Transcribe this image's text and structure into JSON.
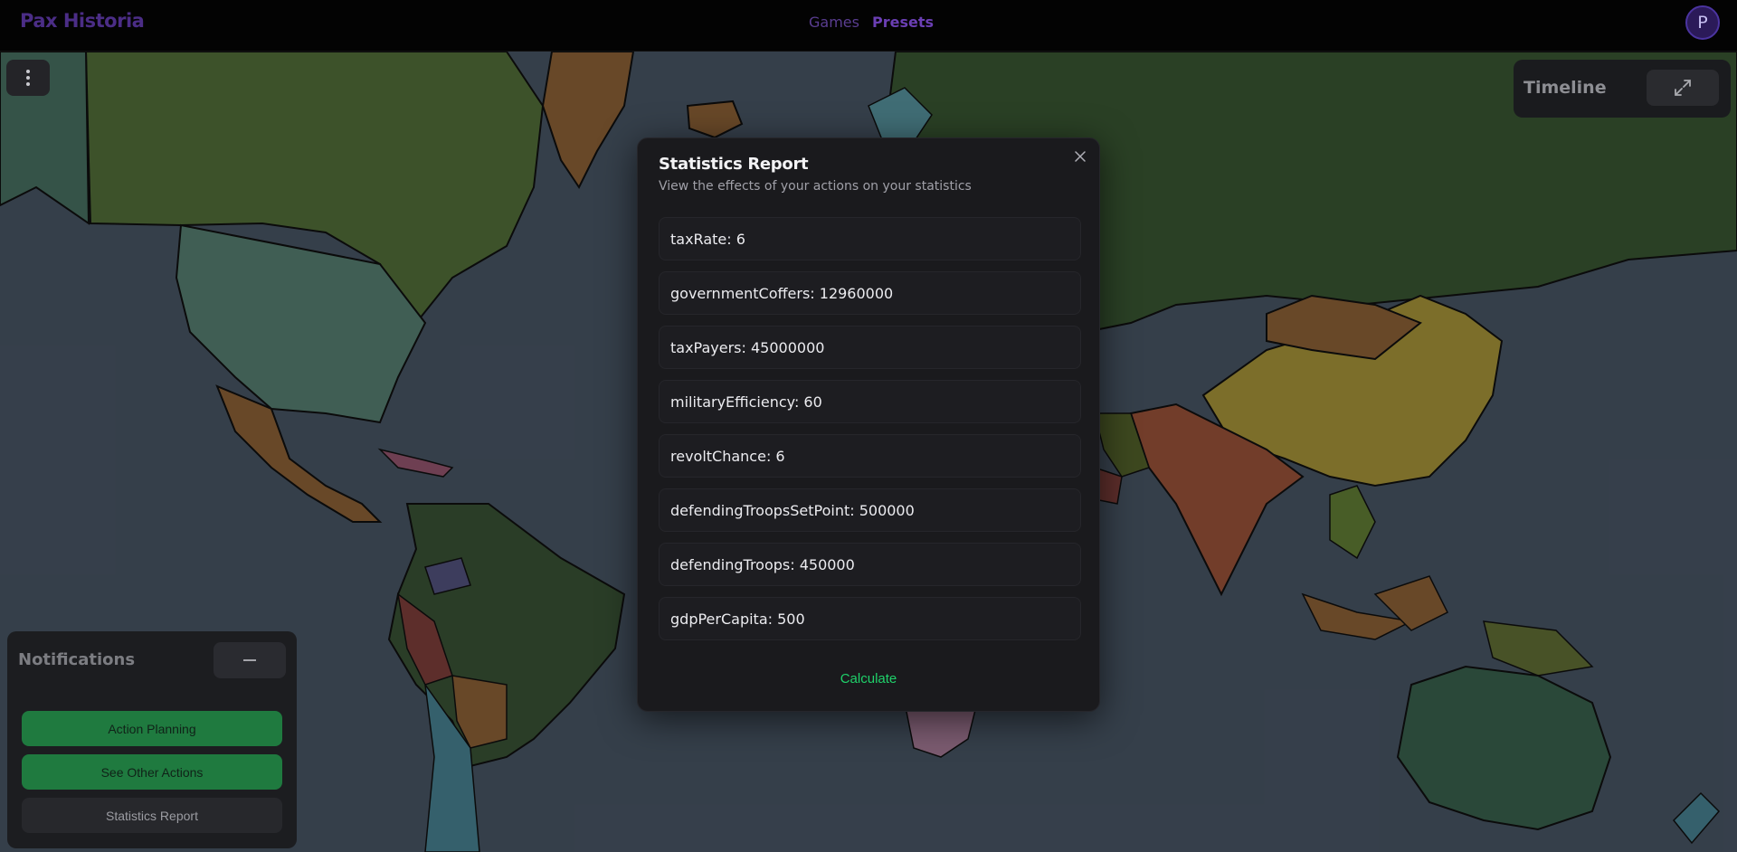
{
  "header": {
    "brand": "Pax Historia",
    "nav": [
      {
        "label": "Games"
      },
      {
        "label": "Presets"
      }
    ],
    "avatar_initial": "P"
  },
  "map_controls": {
    "menu_icon": "vertical-dots-icon"
  },
  "timeline": {
    "label": "Timeline",
    "expand_icon": "expand-arrows-icon"
  },
  "notifications": {
    "title": "Notifications",
    "minimize_icon": "minus-icon",
    "buttons": [
      {
        "label": "Action Planning"
      },
      {
        "label": "See Other Actions"
      },
      {
        "label": "Statistics Report"
      }
    ]
  },
  "modal": {
    "title": "Statistics Report",
    "subtitle": "View the effects of your actions on your statistics",
    "close_icon": "close-icon",
    "stats": [
      {
        "text": "taxRate: 6"
      },
      {
        "text": "governmentCoffers: 12960000"
      },
      {
        "text": "taxPayers: 45000000"
      },
      {
        "text": "militaryEfficiency: 60"
      },
      {
        "text": "revoltChance: 6"
      },
      {
        "text": "defendingTroopsSetPoint: 500000"
      },
      {
        "text": "defendingTroops: 450000"
      },
      {
        "text": "gdpPerCapita: 500"
      }
    ],
    "calculate_label": "Calculate"
  },
  "colors": {
    "brand": "#4b2d86",
    "action_green": "#1f7a3f",
    "calculate_green": "#1fd16a",
    "ocean": "#4f5d6e"
  }
}
